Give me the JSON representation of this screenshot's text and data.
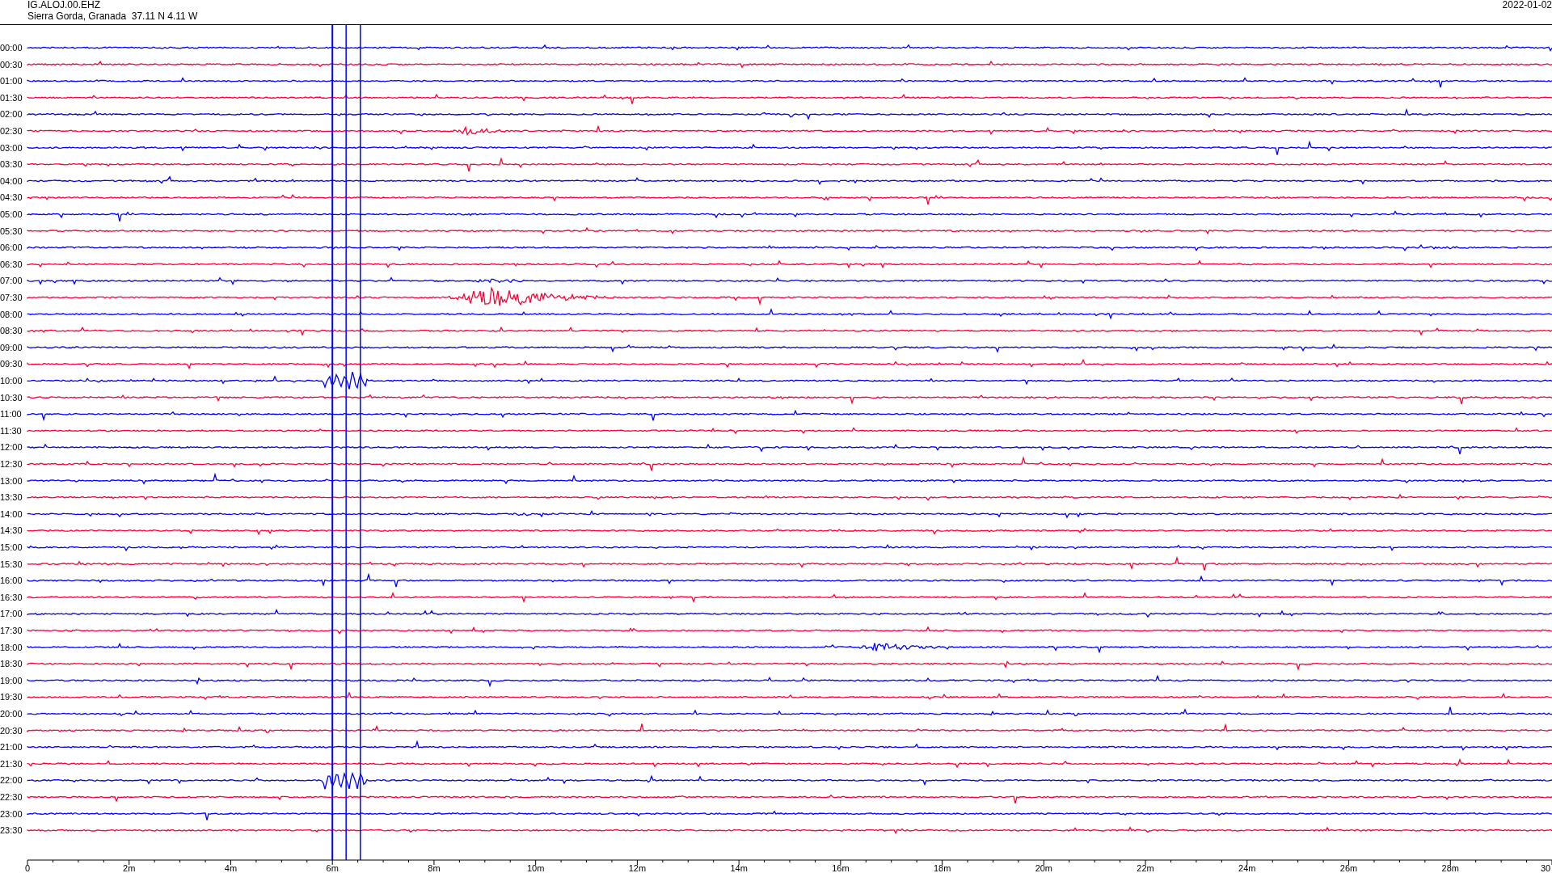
{
  "header": {
    "station": "IG.ALOJ.00.EHZ",
    "location": "Sierra Gorda, Granada  37.11 N 4.11 W",
    "date": "2022-01-02"
  },
  "rows": [
    {
      "label": "00:00",
      "color": "#0000ff"
    },
    {
      "label": "00:30",
      "color": "#ff0033"
    },
    {
      "label": "01:00",
      "color": "#0000ff"
    },
    {
      "label": "01:30",
      "color": "#ff0033"
    },
    {
      "label": "02:00",
      "color": "#0000ff"
    },
    {
      "label": "02:30",
      "color": "#ff0033"
    },
    {
      "label": "03:00",
      "color": "#0000ff"
    },
    {
      "label": "03:30",
      "color": "#ff0033"
    },
    {
      "label": "04:00",
      "color": "#0000ff"
    },
    {
      "label": "04:30",
      "color": "#ff0033"
    },
    {
      "label": "05:00",
      "color": "#0000ff"
    },
    {
      "label": "05:30",
      "color": "#ff0033"
    },
    {
      "label": "06:00",
      "color": "#0000ff"
    },
    {
      "label": "06:30",
      "color": "#ff0033"
    },
    {
      "label": "07:00",
      "color": "#0000ff"
    },
    {
      "label": "07:30",
      "color": "#ff0033"
    },
    {
      "label": "08:00",
      "color": "#0000ff"
    },
    {
      "label": "08:30",
      "color": "#ff0033"
    },
    {
      "label": "09:00",
      "color": "#0000ff"
    },
    {
      "label": "09:30",
      "color": "#ff0033"
    },
    {
      "label": "10:00",
      "color": "#0000ff"
    },
    {
      "label": "10:30",
      "color": "#ff0033"
    },
    {
      "label": "11:00",
      "color": "#0000ff"
    },
    {
      "label": "11:30",
      "color": "#ff0033"
    },
    {
      "label": "12:00",
      "color": "#0000ff"
    },
    {
      "label": "12:30",
      "color": "#ff0033"
    },
    {
      "label": "13:00",
      "color": "#0000ff"
    },
    {
      "label": "13:30",
      "color": "#ff0033"
    },
    {
      "label": "14:00",
      "color": "#0000ff"
    },
    {
      "label": "14:30",
      "color": "#ff0033"
    },
    {
      "label": "15:00",
      "color": "#0000ff"
    },
    {
      "label": "15:30",
      "color": "#ff0033"
    },
    {
      "label": "16:00",
      "color": "#0000ff"
    },
    {
      "label": "16:30",
      "color": "#ff0033"
    },
    {
      "label": "17:00",
      "color": "#0000ff"
    },
    {
      "label": "17:30",
      "color": "#ff0033"
    },
    {
      "label": "18:00",
      "color": "#0000ff"
    },
    {
      "label": "18:30",
      "color": "#ff0033"
    },
    {
      "label": "19:00",
      "color": "#0000ff"
    },
    {
      "label": "19:30",
      "color": "#ff0033"
    },
    {
      "label": "20:00",
      "color": "#0000ff"
    },
    {
      "label": "20:30",
      "color": "#ff0033"
    },
    {
      "label": "21:00",
      "color": "#0000ff"
    },
    {
      "label": "21:30",
      "color": "#ff0033"
    },
    {
      "label": "22:00",
      "color": "#0000ff"
    },
    {
      "label": "22:30",
      "color": "#ff0033"
    },
    {
      "label": "23:00",
      "color": "#0000ff"
    },
    {
      "label": "23:30",
      "color": "#ff0033"
    }
  ],
  "x_axis": {
    "ticks": [
      "0",
      "2m",
      "4m",
      "6m",
      "8m",
      "10m",
      "12m",
      "14m",
      "16m",
      "18m",
      "20m",
      "22m",
      "24m",
      "26m",
      "28m",
      "30"
    ]
  }
}
